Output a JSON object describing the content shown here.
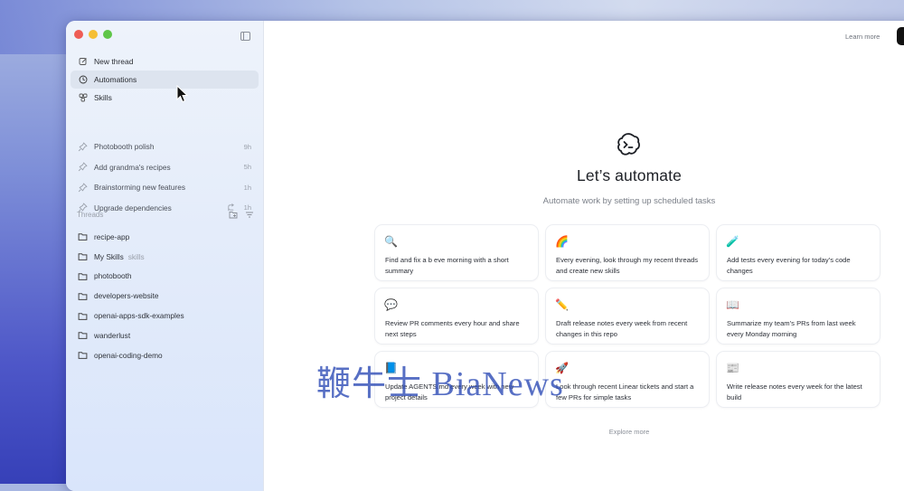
{
  "window": {
    "sidebar": {
      "nav": [
        {
          "label": "New thread",
          "icon": "edit-icon"
        },
        {
          "label": "Automations",
          "icon": "clock-icon",
          "active": true
        },
        {
          "label": "Skills",
          "icon": "skills-icon"
        }
      ],
      "pinned": [
        {
          "label": "Photobooth polish",
          "time": "9h"
        },
        {
          "label": "Add grandma's recipes",
          "time": "5h"
        },
        {
          "label": "Brainstorming new features",
          "time": "1h"
        },
        {
          "label": "Upgrade dependencies",
          "time": "1h",
          "branch": true
        }
      ],
      "threads_label": "Threads",
      "threads": [
        {
          "label": "recipe-app",
          "sub": ""
        },
        {
          "label": "My Skills",
          "sub": "skills"
        },
        {
          "label": "photobooth",
          "sub": ""
        },
        {
          "label": "developers-website",
          "sub": ""
        },
        {
          "label": "openai-apps-sdk-examples",
          "sub": ""
        },
        {
          "label": "wanderlust",
          "sub": ""
        },
        {
          "label": "openai-coding-demo",
          "sub": ""
        }
      ]
    },
    "main": {
      "learn_more": "Learn more",
      "hero_icon": "terminal-bubble-icon",
      "title": "Let’s automate",
      "subtitle": "Automate work by setting up scheduled tasks",
      "cards": [
        {
          "emoji": "🔍",
          "text": "Find and fix a b   eve   morning with a short summary"
        },
        {
          "emoji": "🌈",
          "text": "Every evening, look through my recent threads and create new skills"
        },
        {
          "emoji": "🧪",
          "text": "Add tests every evening for today’s code changes"
        },
        {
          "emoji": "💬",
          "text": "Review PR comments every hour and share next steps"
        },
        {
          "emoji": "✏️",
          "text": "Draft release notes every week from recent changes in this repo"
        },
        {
          "emoji": "📖",
          "text": "Summarize my team’s PRs from last week every Monday morning"
        },
        {
          "emoji": "📘",
          "text": "Update AGENTS.md every week with new project details"
        },
        {
          "emoji": "🚀",
          "text": "Look through recent Linear tickets and start a few PRs for simple tasks"
        },
        {
          "emoji": "📰",
          "text": "Write release notes every week for the latest build"
        }
      ],
      "explore_more": "Explore more"
    }
  },
  "watermark": "鞭牛士 BiaNews",
  "colors": {
    "traffic_red": "#ee5c55",
    "traffic_yellow": "#f5bf34",
    "traffic_green": "#5fc548",
    "active_item_bg": "#dde4ef",
    "watermark": "#2846b4"
  }
}
